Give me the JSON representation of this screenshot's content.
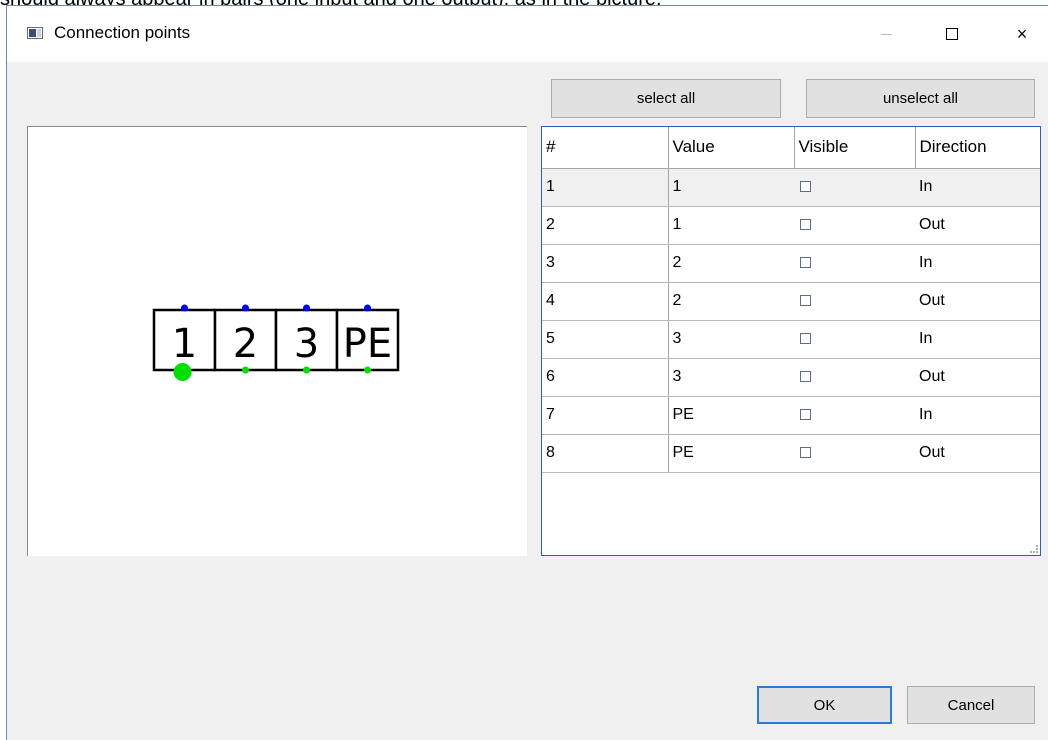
{
  "top_caption": "should always appear in pairs (one input and one output), as in the picture.",
  "window": {
    "title": "Connection points",
    "icon": "app-window-icon",
    "controls": {
      "minimize": "minimize-icon",
      "maximize": "maximize-icon",
      "close": "×"
    }
  },
  "toolbar": {
    "select_all": "select all",
    "unselect_all": "unselect all"
  },
  "preview": {
    "terminals": [
      "1",
      "2",
      "3",
      "PE"
    ],
    "selected_index": 0,
    "colors": {
      "input_dot": "#0000ff",
      "output_dot": "#00e000",
      "selected_dot": "#00e000"
    }
  },
  "grid": {
    "columns": [
      "#",
      "Value",
      "Visible",
      "Direction"
    ],
    "rows": [
      {
        "num": "1",
        "value": "1",
        "visible": false,
        "direction": "In"
      },
      {
        "num": "2",
        "value": "1",
        "visible": false,
        "direction": "Out"
      },
      {
        "num": "3",
        "value": "2",
        "visible": false,
        "direction": "In"
      },
      {
        "num": "4",
        "value": "2",
        "visible": false,
        "direction": "Out"
      },
      {
        "num": "5",
        "value": "3",
        "visible": false,
        "direction": "In"
      },
      {
        "num": "6",
        "value": "3",
        "visible": false,
        "direction": "Out"
      },
      {
        "num": "7",
        "value": "PE",
        "visible": false,
        "direction": "In"
      },
      {
        "num": "8",
        "value": "PE",
        "visible": false,
        "direction": "Out"
      }
    ],
    "selected_row": 0
  },
  "dialog_buttons": {
    "ok": "OK",
    "cancel": "Cancel"
  }
}
